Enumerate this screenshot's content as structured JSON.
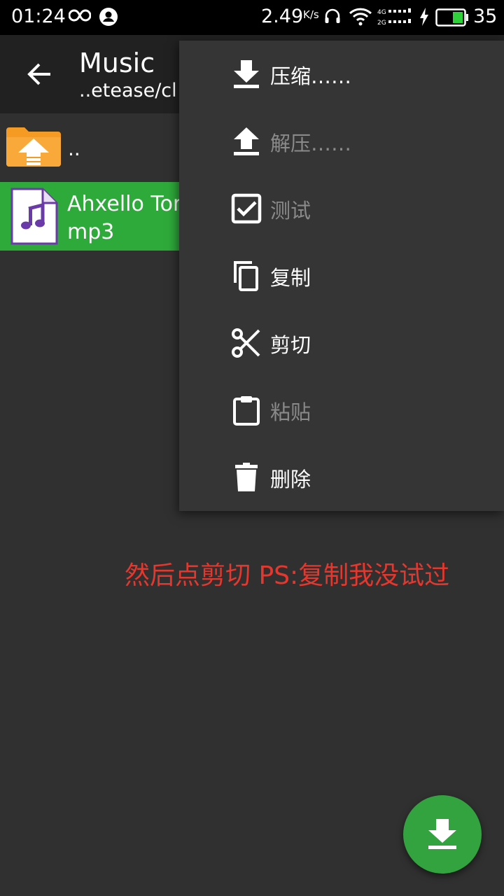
{
  "status_bar": {
    "time": "01:24",
    "net_speed": "2.49",
    "net_speed_unit": "K/s",
    "battery_level": "35",
    "icons": [
      "infinity-icon",
      "avatar-icon",
      "headset-icon",
      "wifi-icon",
      "signal-icon",
      "charging-icon",
      "battery-icon"
    ]
  },
  "app_bar": {
    "title": "Music",
    "subtitle": "..etease/cl",
    "back_icon": "arrow-left-icon"
  },
  "file_list": {
    "parent": {
      "label": "..",
      "icon": "folder-up-icon"
    },
    "items": [
      {
        "name": "Ahxello Tor\nmp3",
        "icon": "music-file-icon",
        "selected": true
      }
    ]
  },
  "menu": {
    "items": [
      {
        "label": "压缩……",
        "icon": "download-icon",
        "enabled": true
      },
      {
        "label": "解压……",
        "icon": "upload-icon",
        "enabled": false
      },
      {
        "label": "测试",
        "icon": "checkbox-icon",
        "enabled": false
      },
      {
        "label": "复制",
        "icon": "copy-icon",
        "enabled": true
      },
      {
        "label": "剪切",
        "icon": "scissors-icon",
        "enabled": true
      },
      {
        "label": "粘贴",
        "icon": "clipboard-icon",
        "enabled": false
      },
      {
        "label": "删除",
        "icon": "trash-icon",
        "enabled": true
      }
    ]
  },
  "annotation": {
    "text": "然后点剪切 PS:复制我没试过"
  },
  "fab": {
    "icon": "download-icon"
  },
  "colors": {
    "background": "#303030",
    "app_bar": "#212121",
    "menu": "#353535",
    "selected_row": "#2eaa3a",
    "fab": "#32a33e",
    "annotation": "#e5372d",
    "folder": "#f59a23",
    "music_note": "#6a3aa8"
  }
}
